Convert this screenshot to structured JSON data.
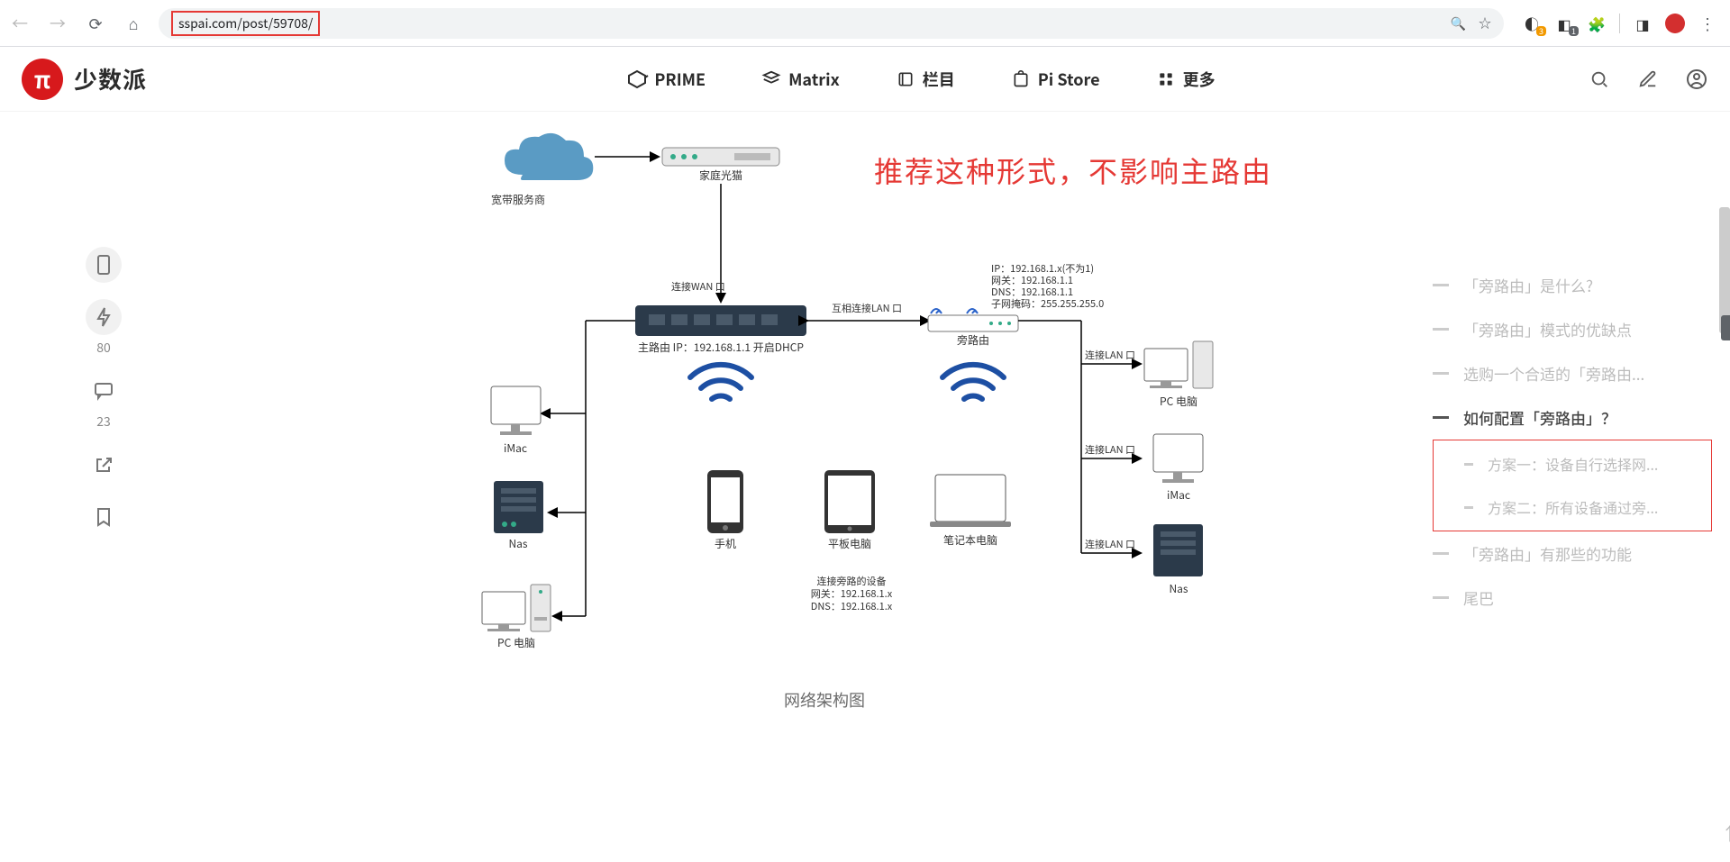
{
  "browser": {
    "url": "sspai.com/post/59708/",
    "ext_badge1": "3",
    "ext_badge2": "1"
  },
  "site": {
    "logo_glyph": "π",
    "logo_text": "少数派",
    "nav": [
      "PRIME",
      "Matrix",
      "栏目",
      "Pi Store",
      "更多"
    ]
  },
  "sidebar": {
    "count_zap": "80",
    "count_comment": "23"
  },
  "diagram": {
    "annotation": "推荐这种形式，不影响主路由",
    "caption": "网络架构图",
    "labels": {
      "isp": "宽带服务商",
      "modem": "家庭光猫",
      "wan": "连接WAN 口",
      "interlan": "互相连接LAN 口",
      "main_router": "主路由 IP：192.168.1.1 开启DHCP",
      "side_router_name": "旁路由",
      "side_router_info": "IP：192.168.1.x(不为1)\n网关：192.168.1.1\nDNS：192.168.1.1\n子网掩码：255.255.255.0",
      "lan": "连接LAN 口",
      "dev_imac": "iMac",
      "dev_nas": "Nas",
      "dev_pc": "PC 电脑",
      "dev_phone": "手机",
      "dev_tablet": "平板电脑",
      "dev_laptop": "笔记本电脑",
      "dhcp_info": "连接旁路的设备\n网关：192.168.1.x\nDNS：192.168.1.x"
    }
  },
  "toc": {
    "items": [
      {
        "text": "「旁路由」是什么?",
        "active": false,
        "sub": false
      },
      {
        "text": "「旁路由」模式的优缺点",
        "active": false,
        "sub": false
      },
      {
        "text": "选购一个合适的「旁路由...",
        "active": false,
        "sub": false
      },
      {
        "text": "如何配置「旁路由」？",
        "active": true,
        "sub": false
      },
      {
        "text": "方案一：设备自行选择网...",
        "active": false,
        "sub": true
      },
      {
        "text": "方案二：所有设备通过旁...",
        "active": false,
        "sub": true
      },
      {
        "text": "「旁路由」有那些的功能",
        "active": false,
        "sub": false
      },
      {
        "text": "尾巴",
        "active": false,
        "sub": false
      }
    ]
  }
}
